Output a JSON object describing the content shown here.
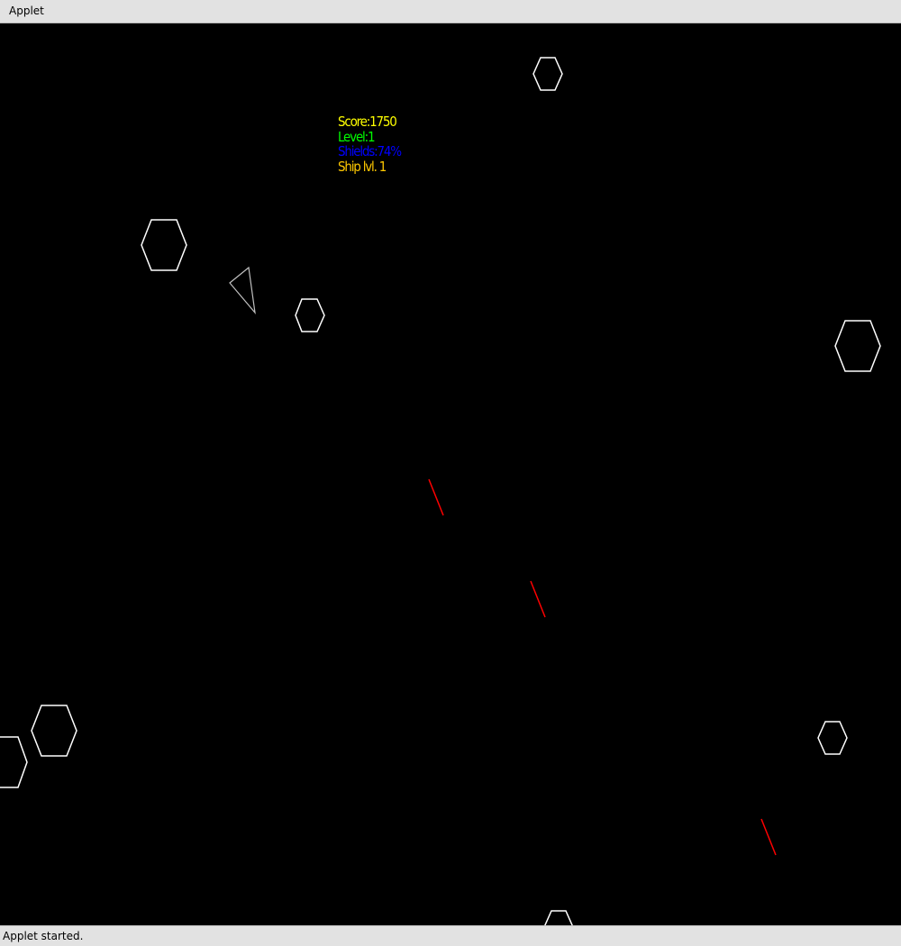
{
  "window": {
    "title": "Applet"
  },
  "hud": {
    "score": "Score:1750",
    "level": "Level:1",
    "shields": "Shields:74%",
    "ship_level": "Ship lvl. 1",
    "colors": {
      "score": "#ffff00",
      "level": "#00ff00",
      "shields": "#0000ff",
      "ship_level": "#ffc800"
    }
  },
  "game": {
    "background": "#000000",
    "asteroid_color": "#ffffff",
    "ship_color": "#c0c0c0",
    "bullet_color": "#ff0000",
    "asteroid_count": 8,
    "bullet_count": 3
  },
  "status": {
    "text": "Applet started."
  }
}
